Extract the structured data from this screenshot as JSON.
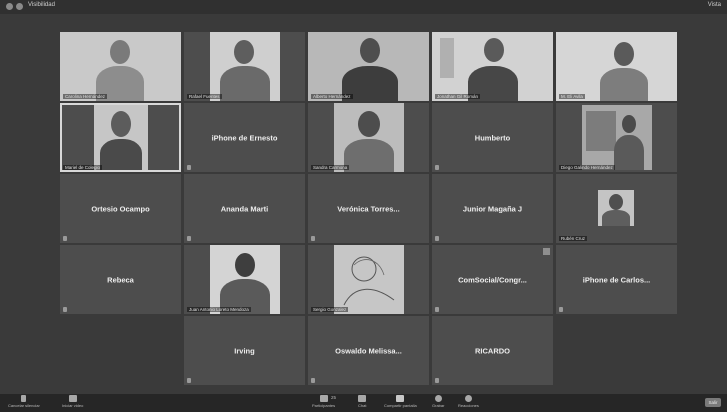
{
  "window": {
    "title": "Visibilidad",
    "top_right": "Vista"
  },
  "tiles": [
    {
      "id": "r1c1",
      "label": "Carolina Hernández",
      "type": "video"
    },
    {
      "id": "r1c2",
      "label": "Rafael Fuentes",
      "type": "video"
    },
    {
      "id": "r1c3",
      "label": "Alberto Hernández",
      "type": "video"
    },
    {
      "id": "r1c4",
      "label": "Jonathan Gil Román",
      "type": "video"
    },
    {
      "id": "r1c5",
      "label": "M. Eli Avila",
      "type": "video"
    },
    {
      "id": "r2c1",
      "label": "Mariel de Colegio",
      "type": "video",
      "active": true
    },
    {
      "id": "r2c2",
      "name": "iPhone de Ernesto",
      "type": "name"
    },
    {
      "id": "r2c3",
      "label": "Sandra Carmona",
      "type": "video"
    },
    {
      "id": "r2c4",
      "name": "Humberto",
      "type": "name"
    },
    {
      "id": "r2c5",
      "label": "Diego Galindo Hernández",
      "type": "video"
    },
    {
      "id": "r3c1",
      "name": "Ortesio Ocampo",
      "type": "name"
    },
    {
      "id": "r3c2",
      "name": "Ananda Marti",
      "type": "name"
    },
    {
      "id": "r3c3",
      "name": "Verónica Torres...",
      "type": "name"
    },
    {
      "id": "r3c4",
      "name": "Junior Magaña J",
      "type": "name"
    },
    {
      "id": "r3c5",
      "label": "Rubén Cruz",
      "type": "video"
    },
    {
      "id": "r4c1",
      "name": "Rebeca",
      "type": "name"
    },
    {
      "id": "r4c2",
      "label": "Juan Antonio Loreto Mendoza",
      "type": "video"
    },
    {
      "id": "r4c3",
      "label": "Sergio Gonzalez",
      "type": "video"
    },
    {
      "id": "r4c4",
      "name": "ComSocial/Congr...",
      "type": "name"
    },
    {
      "id": "r4c5",
      "name": "iPhone de Carlos...",
      "type": "name"
    },
    {
      "id": "r5c2",
      "name": "Irving",
      "type": "name"
    },
    {
      "id": "r5c3",
      "name": "Oswaldo Melissa...",
      "type": "name"
    },
    {
      "id": "r5c4",
      "name": "RICARDO",
      "type": "name"
    }
  ],
  "toolbar": {
    "mute": "Cancelar silenciar",
    "video": "Iniciar video",
    "participants": "Participantes",
    "participants_count": "25",
    "chat": "Chat",
    "share": "Compartir pantalla",
    "record": "Grabar",
    "reactions": "Reacciones",
    "end": "Salir"
  }
}
